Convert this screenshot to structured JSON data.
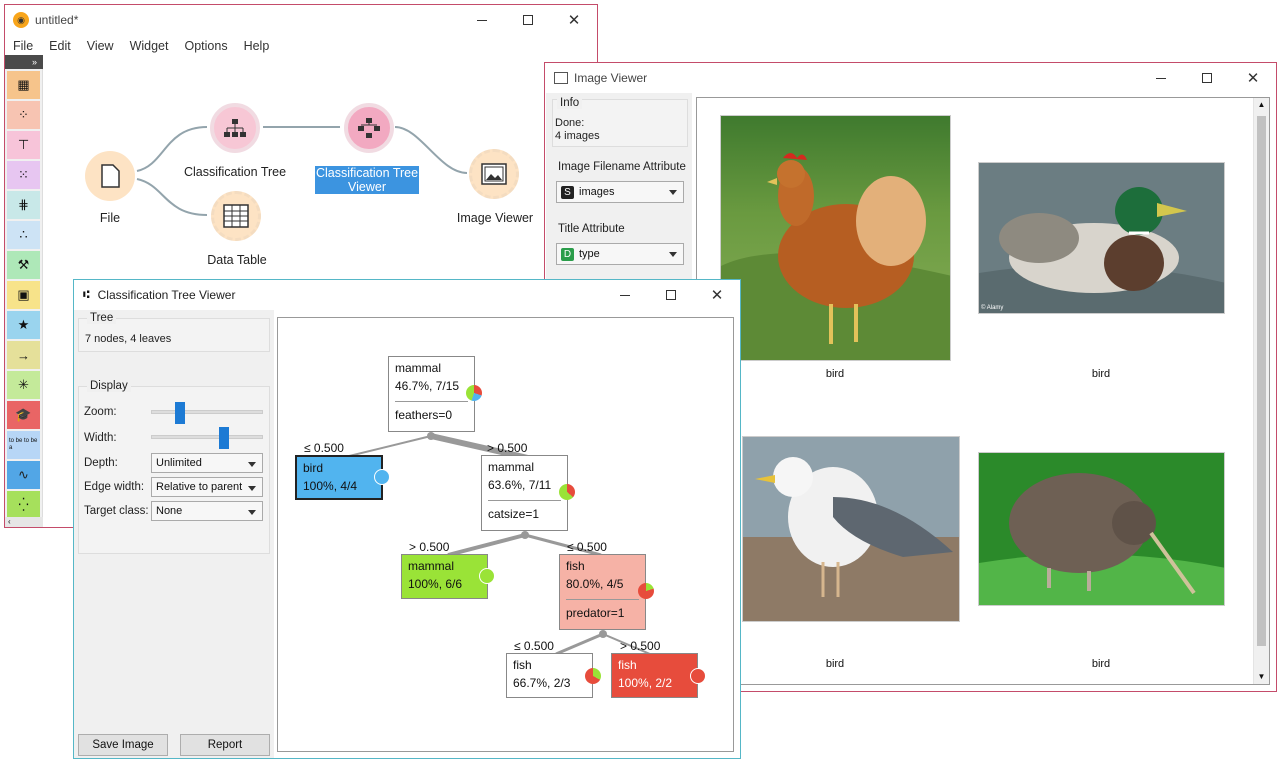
{
  "main": {
    "title": "untitled*",
    "menu": [
      "File",
      "Edit",
      "View",
      "Widget",
      "Options",
      "Help"
    ],
    "nodes": {
      "file": "File",
      "classification_tree": "Classification Tree",
      "tree_viewer_l1": "Classification Tree",
      "tree_viewer_l2": "Viewer",
      "image_viewer": "Image Viewer",
      "data_table": "Data Table"
    },
    "toolbox_tiles": [
      "table-icon",
      "scatter-icon",
      "tree-icon",
      "scatter-dots-icon",
      "tree-grid-icon",
      "points-icon",
      "gear-person-icon",
      "image-icon",
      "star-icon",
      "arrows-icon",
      "network-icon",
      "graduation-cap-icon",
      "to-be-text-icon",
      "line-chart-icon",
      "scatter-small-icon"
    ],
    "to_be_text": "to be to be a"
  },
  "image_viewer": {
    "title": "Image Viewer",
    "info_title": "Info",
    "info_line1": "Done:",
    "info_line2": "4 images",
    "filename_attr_title": "Image Filename Attribute",
    "filename_attr_value": "images",
    "filename_badge": "S",
    "title_attr_title": "Title Attribute",
    "title_attr_value": "type",
    "title_badge": "D",
    "captions": [
      "bird",
      "bird",
      "bird",
      "bird"
    ],
    "watermark": "© Alamy"
  },
  "tree_viewer": {
    "title": "Classification Tree Viewer",
    "tree_title": "Tree",
    "tree_info": "7 nodes, 4 leaves",
    "display_title": "Display",
    "zoom_label": "Zoom:",
    "width_label": "Width:",
    "depth_label": "Depth:",
    "depth_value": "Unlimited",
    "edge_label": "Edge width:",
    "edge_value": "Relative to parent",
    "target_label": "Target class:",
    "target_value": "None",
    "zoom_level": 0.25,
    "width_level": 0.65,
    "save_button": "Save Image",
    "report_button": "Report",
    "nodes": {
      "root": {
        "cls": "mammal",
        "stat": "46.7%, 7/15",
        "split": "feathers=0"
      },
      "bird": {
        "cls": "bird",
        "stat": "100%, 4/4"
      },
      "mid": {
        "cls": "mammal",
        "stat": "63.6%, 7/11",
        "split": "catsize=1"
      },
      "mammal_leaf": {
        "cls": "mammal",
        "stat": "100%, 6/6"
      },
      "fish": {
        "cls": "fish",
        "stat": "80.0%, 4/5",
        "split": "predator=1"
      },
      "fish_leaf1": {
        "cls": "fish",
        "stat": "66.7%, 2/3"
      },
      "fish_leaf2": {
        "cls": "fish",
        "stat": "100%, 2/2"
      }
    },
    "edges": {
      "root_left": "≤ 0.500",
      "root_right": "> 0.500",
      "mid_left": "> 0.500",
      "mid_right": "≤ 0.500",
      "fish_left": "≤ 0.500",
      "fish_right": "> 0.500"
    },
    "colors": {
      "bird": "#51b4ef",
      "mammal": "#9ae337",
      "fish": "#e74c3c",
      "fish_light": "#f6b2a6"
    }
  }
}
